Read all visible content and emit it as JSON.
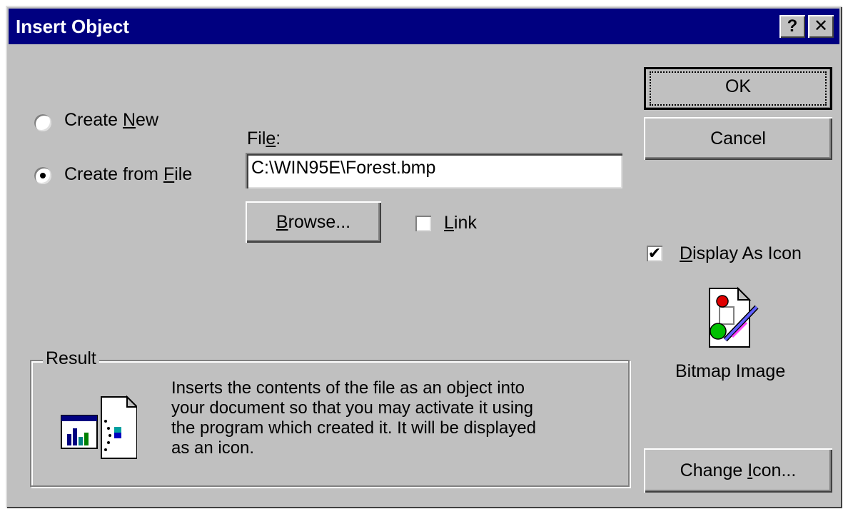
{
  "window": {
    "title": "Insert Object",
    "help_glyph": "?",
    "close_glyph": "✕"
  },
  "options": {
    "create_new": {
      "prefix": "Create ",
      "accel": "N",
      "suffix": "ew"
    },
    "create_from_file": {
      "prefix": "Create from ",
      "accel": "F",
      "suffix": "ile",
      "selected": true
    }
  },
  "file": {
    "label_prefix": "Fil",
    "label_accel": "e",
    "label_suffix": ":",
    "value": "C:\\WIN95E\\Forest.bmp"
  },
  "browse": {
    "accel": "B",
    "suffix": "rowse..."
  },
  "link": {
    "accel": "L",
    "suffix": "ink",
    "checked": false
  },
  "buttons": {
    "ok": "OK",
    "cancel": "Cancel"
  },
  "display_as_icon": {
    "accel": "D",
    "suffix": "isplay As Icon",
    "checked": true
  },
  "icon": {
    "caption": "Bitmap Image",
    "icon_name": "bitmap-image-icon"
  },
  "change_icon": {
    "prefix": "Change ",
    "accel": "I",
    "suffix": "con..."
  },
  "result": {
    "legend": "Result",
    "lines": [
      "Inserts the contents of the file as an object into",
      "your document so that you may activate it using",
      "the program which created it.  It will be displayed",
      "as an icon."
    ]
  },
  "colors": {
    "titlebar": "#000080",
    "face": "#c0c0c0"
  }
}
